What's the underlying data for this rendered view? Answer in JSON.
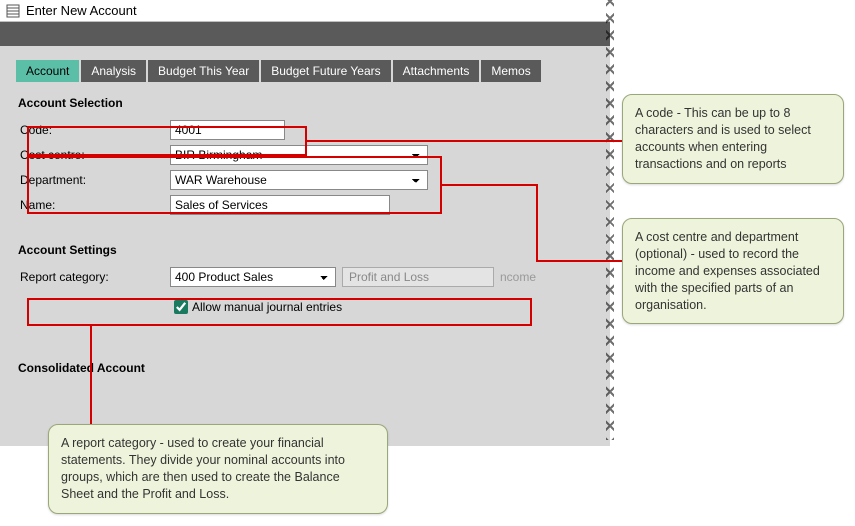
{
  "window": {
    "title": "Enter New Account"
  },
  "tabs": [
    {
      "label": "Account"
    },
    {
      "label": "Analysis"
    },
    {
      "label": "Budget This Year"
    },
    {
      "label": "Budget Future Years"
    },
    {
      "label": "Attachments"
    },
    {
      "label": "Memos"
    }
  ],
  "sections": {
    "selection_title": "Account Selection",
    "settings_title": "Account Settings",
    "consolidated_title": "Consolidated Account"
  },
  "fields": {
    "code_label": "Code:",
    "code_value": "4001",
    "cost_centre_label": "Cost centre:",
    "cost_centre_value": "BIR Birmingham",
    "department_label": "Department:",
    "department_value": "WAR Warehouse",
    "name_label": "Name:",
    "name_value": "Sales of Services",
    "report_category_label": "Report category:",
    "report_category_value": "400 Product Sales",
    "report_type_value": "Profit and Loss",
    "income_value": "ncome",
    "allow_manual_label": "Allow manual journal entries"
  },
  "callouts": {
    "code": " A code - This can be up to 8 characters and is used to select accounts when entering transactions and on reports",
    "cost_dept": " A cost centre and department (optional) - used to record the income and expenses associated with the specified parts of an organisation.",
    "report_cat": " A report category - used to create your financial statements. They divide your nominal accounts into groups, which are then used to create the Balance Sheet and the Profit and Loss."
  },
  "colors": {
    "tab_active_bg": "#5bbfa8",
    "tab_bg": "#5a5a5a",
    "highlight": "#d40000",
    "callout_bg": "#eef4db"
  }
}
